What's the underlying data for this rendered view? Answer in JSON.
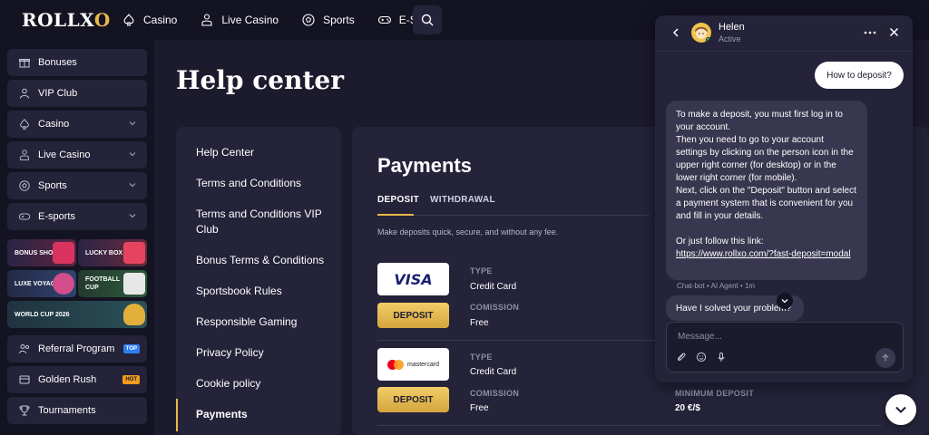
{
  "brand": {
    "logo_text_1": "ROLL",
    "logo_text_x": "X",
    "logo_text_o": "O"
  },
  "topnav": {
    "items": [
      {
        "label": "Casino",
        "icon": "spade-icon"
      },
      {
        "label": "Live Casino",
        "icon": "dealer-icon"
      },
      {
        "label": "Sports",
        "icon": "soccer-ball-icon"
      },
      {
        "label": "E-Sports",
        "icon": "gamepad-icon"
      }
    ],
    "search_icon": "search-icon"
  },
  "sidebar": {
    "items": [
      {
        "label": "Bonuses",
        "icon": "gift-icon"
      },
      {
        "label": "VIP Club",
        "icon": "vip-user-icon"
      },
      {
        "label": "Casino",
        "icon": "spade-icon"
      },
      {
        "label": "Live Casino",
        "icon": "dealer-icon"
      },
      {
        "label": "Sports",
        "icon": "soccer-ball-icon"
      },
      {
        "label": "E-sports",
        "icon": "gamepad-icon"
      }
    ],
    "tiles": [
      {
        "label": "BONUS SHOP"
      },
      {
        "label": "LUCKY BOX"
      },
      {
        "label": "LUXE VOYAGE"
      },
      {
        "label": "FOOTBALL CUP"
      },
      {
        "label": "WORLD CUP 2026"
      }
    ],
    "bottom_items": [
      {
        "label": "Referral Program",
        "badge": "TOP"
      },
      {
        "label": "Golden Rush",
        "badge": "HOT"
      },
      {
        "label": "Tournaments"
      }
    ]
  },
  "page": {
    "title": "Help center"
  },
  "help_nav": {
    "items": [
      "Help Center",
      "Terms and Conditions",
      "Terms and Conditions VIP Club",
      "Bonus Terms & Conditions",
      "Sportsbook Rules",
      "Responsible Gaming",
      "Privacy Policy",
      "Cookie policy",
      "Payments"
    ],
    "active": "Payments"
  },
  "payments": {
    "title": "Payments",
    "tabs": [
      "DEPOSIT",
      "WITHDRAWAL"
    ],
    "active_tab": "DEPOSIT",
    "subtitle": "Make deposits quick, secure, and without any fee.",
    "deposit_label": "DEPOSIT",
    "rows": [
      {
        "logo": "VISA",
        "type_label": "TYPE",
        "type": "Credit Card",
        "commission_label": "COMISSION",
        "commission": "Free"
      },
      {
        "logo": "mastercard",
        "type_label": "TYPE",
        "type": "Credit Card",
        "commission_label": "COMISSION",
        "commission": "Free",
        "min_label": "MINIMUM DEPOSIT",
        "min": "20 €/$"
      }
    ]
  },
  "chat": {
    "agent_name": "Helen",
    "agent_status": "Active",
    "user_message": "How to deposit?",
    "bot_message_lines": [
      "To make a deposit, you must first log in to your account.",
      "Then you need to go to your account settings by clicking on the person icon in the upper right corner (for desktop) or in the lower right corner (for mobile).",
      "Next, click on the \"Deposit\" button and select a payment system that is convenient for you and fill in your details.",
      "",
      "Or just follow this link:"
    ],
    "bot_link": "https://www.rollxo.com/?fast-deposit=modal",
    "bot_meta": "Chat-bot • AI Agent • 1m",
    "quick_reply": "Have I solved your problem?",
    "composer_placeholder": "Message..."
  },
  "colors": {
    "accent": "#e9b949",
    "bg": "#1c1b2e",
    "panel": "#24233a"
  }
}
